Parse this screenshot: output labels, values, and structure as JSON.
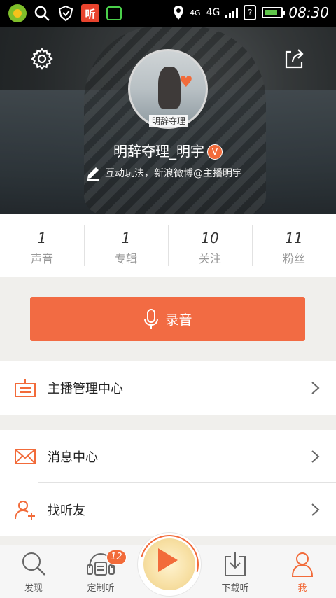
{
  "status_bar": {
    "ting_app_label": "听",
    "net_top": "4G",
    "net_label": "4G",
    "time": "08:30",
    "battery_level": 0.7
  },
  "header": {
    "avatar_caption": "明辞夺理",
    "username": "明辞夺理_明宇",
    "verified_badge": "V",
    "bio": "互动玩法，新浪微博@主播明宇"
  },
  "stats": [
    {
      "value": "1",
      "label": "声音"
    },
    {
      "value": "1",
      "label": "专辑"
    },
    {
      "value": "10",
      "label": "关注"
    },
    {
      "value": "11",
      "label": "粉丝"
    }
  ],
  "record_button": {
    "label": "录音"
  },
  "menu": {
    "anchor_center": "主播管理中心",
    "message_center": "消息中心",
    "find_friends": "找听友"
  },
  "bottom_nav": {
    "discover": "发现",
    "custom_listen": "定制听",
    "custom_badge": "12",
    "downloads": "下载听",
    "me": "我"
  },
  "colors": {
    "accent": "#f26b3a",
    "record_button": "#f26b43",
    "background": "#f0efec"
  }
}
